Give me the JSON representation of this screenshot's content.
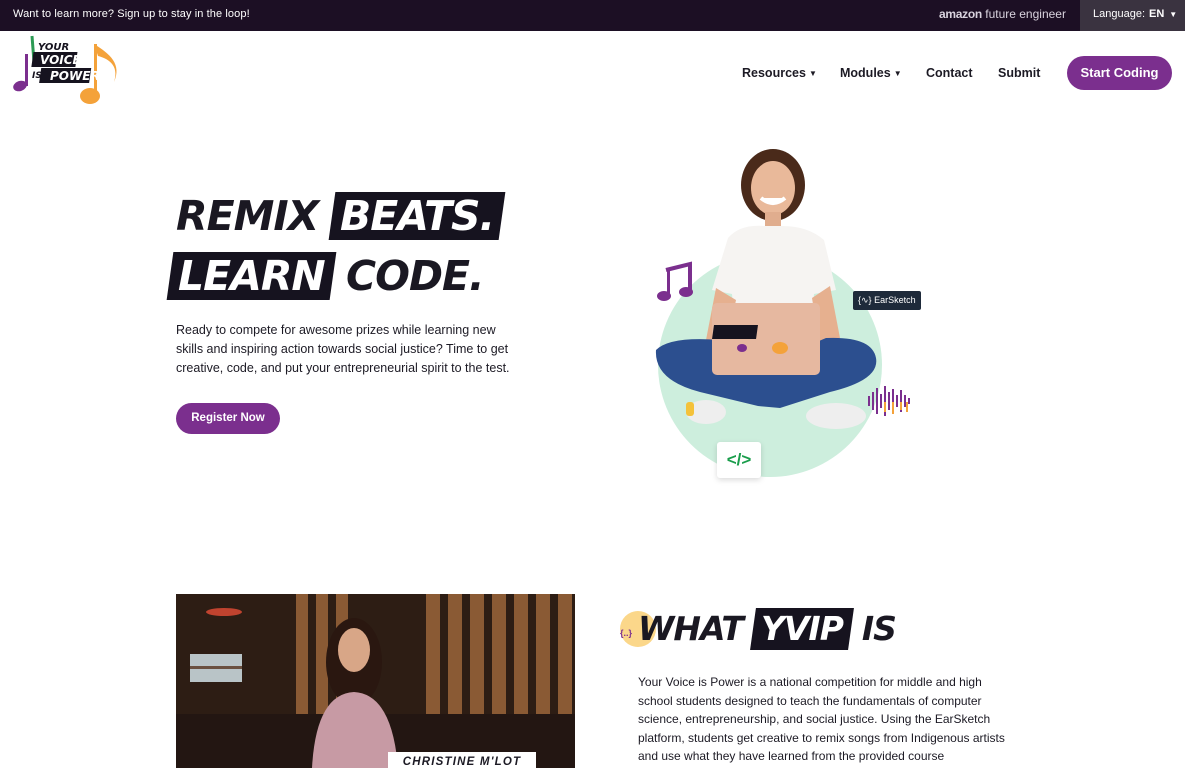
{
  "topbar": {
    "signup_text": "Want to learn more? Sign up to stay in the loop!",
    "partner_prefix": "amazon",
    "partner_suffix": "future engineer",
    "language_label": "Language:",
    "language_code": "EN"
  },
  "header": {
    "logo_lines": [
      "YOUR",
      "VOICE",
      "IS",
      "POWER"
    ],
    "nav": [
      {
        "label": "Resources",
        "dropdown": true
      },
      {
        "label": "Modules",
        "dropdown": true
      },
      {
        "label": "Contact",
        "dropdown": false
      },
      {
        "label": "Submit",
        "dropdown": false
      }
    ],
    "cta_label": "Start Coding"
  },
  "hero": {
    "line1_plain": "REMIX",
    "line1_boxed": "BEATS.",
    "line2_boxed": "LEARN",
    "line2_plain": "CODE.",
    "intro": "Ready to compete for awesome prizes while learning new skills and inspiring action towards social justice? Time to get creative, code, and put your entrepreneurial spirit to the test.",
    "register_label": "Register Now",
    "earsketch_tag": "EarSketch",
    "earsketch_glyph": "{∿}",
    "code_glyph": "</>"
  },
  "about": {
    "video_caption": "CHRISTINE M'LOT",
    "heading_plain1": "WHAT",
    "heading_boxed": "YVIP",
    "heading_plain2": "IS",
    "heading_glyph": "{..}",
    "body": "Your Voice is Power is a national competition for middle and high school students designed to teach the fundamentals of computer science, entrepreneurship, and social justice. Using the EarSketch platform, students get creative to remix songs from Indigenous artists and use what they have learned from the provided course"
  },
  "colors": {
    "brand_purple": "#7b2f8e",
    "topbar_bg": "#1c0f24",
    "mint": "#cdeedd",
    "accent_orange": "#f4a23a",
    "code_green": "#1a9d4b"
  }
}
